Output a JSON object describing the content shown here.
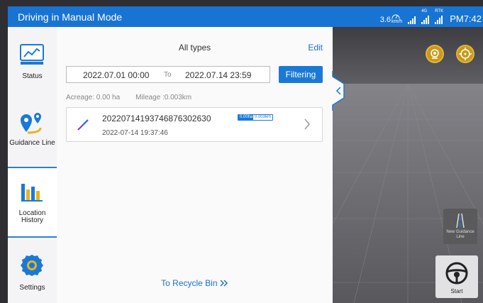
{
  "status_bar": {
    "title": "Driving in Manual Mode",
    "speed": "3.6",
    "speed_unit": "km/h",
    "network_label": "4G",
    "rtk_label": "RTK",
    "clock": "PM7:42"
  },
  "sidebar": {
    "items": [
      {
        "label": "Status",
        "icon": "status-chart-icon"
      },
      {
        "label": "Guidance Line",
        "icon": "guidance-pin-icon"
      },
      {
        "label": "Location History",
        "icon": "history-bars-icon"
      },
      {
        "label": "Settings",
        "icon": "gear-icon"
      }
    ],
    "active_index": 2
  },
  "panel": {
    "type_filter": "All types",
    "edit_label": "Edit",
    "date_from": "2022.07.01 00:00",
    "date_to_sep": "To",
    "date_to": "2022.07.14 23:59",
    "filter_button": "Filtering",
    "acreage": "Acreage: 0.00 ha",
    "mileage": "Mileage :0.003km",
    "records": [
      {
        "id": "20220714193746876302630",
        "acreage_badge": "0.00ha",
        "mileage_badge": "0.003km",
        "date": "2022-07-14 19:37:46"
      }
    ],
    "recycle_link": "To Recycle Bin"
  },
  "map": {
    "new_guidance_line": "New Guidance Line",
    "start_label": "Start"
  },
  "colors": {
    "primary": "#1874d2",
    "accent": "#c99a1a"
  }
}
